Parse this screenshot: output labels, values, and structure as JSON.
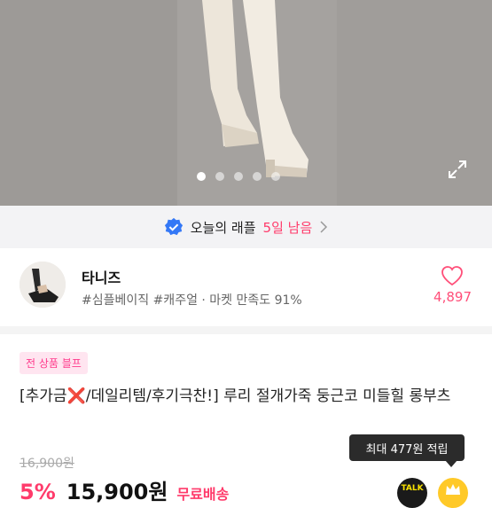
{
  "gallery": {
    "dot_count": 5,
    "active_index": 0,
    "image_name": "product-photo-ivory-boots",
    "expand_icon": "expand-icon"
  },
  "banner": {
    "title": "오늘의 래플",
    "days_left": "5일 남음",
    "icon": "verified-check-icon",
    "accent": "#ff3b6b"
  },
  "seller": {
    "name": "타니즈",
    "tags": "#심플베이직 #캐주얼 · 마켓 만족도 91%",
    "like_count": "4,897",
    "like_color": "#ff4f79"
  },
  "product": {
    "badge": "전 상품 블프",
    "title": "[추가금❌/데일리템/후기극찬!] 루리 절개가죽 둥근코 미들힐 롱부츠",
    "original_price": "16,900원",
    "discount": "5%",
    "price": "15,900원",
    "shipping": "무료배송"
  },
  "tooltip": {
    "text": "최대 477원 적립"
  },
  "actions": {
    "talk_label": "TALK"
  }
}
